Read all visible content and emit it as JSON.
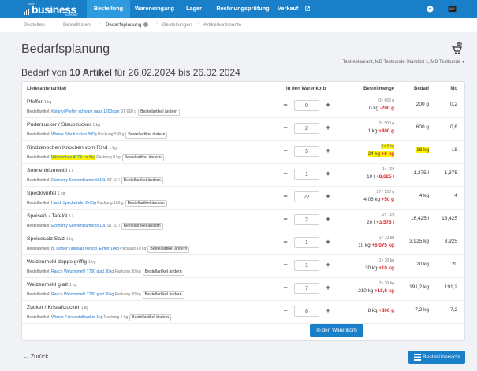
{
  "nav": {
    "logo_pre": "mein",
    "logo_main": "business",
    "logo_sub": "Einkauf",
    "tabs": [
      {
        "label": "Bestellung"
      },
      {
        "label": "Wareneingang"
      },
      {
        "label": "Lager"
      },
      {
        "label": "Rechnungsprüfung"
      },
      {
        "label": "Verkauf"
      }
    ],
    "icons": [
      "help-icon",
      "user-card-icon"
    ]
  },
  "breadcrumb": [
    {
      "label": "Bestellen"
    },
    {
      "label": "Bestelllisten"
    },
    {
      "label": "Bedarfsplanung"
    },
    {
      "label": "Bestellungen"
    },
    {
      "label": "Artikelsortimente"
    }
  ],
  "page": {
    "title": "Bedarfsplanung",
    "cart_count": "24",
    "store": "Testrestaurant, MB Testkunde Standort 1, MB Testkunde",
    "subtitle_pre": "Bedarf von ",
    "subtitle_count": "10 Artikel",
    "subtitle_post": " für 26.02.2024 bis 26.02.2024"
  },
  "table": {
    "headers": [
      "Lieferantenartikel",
      "In den Warenkorb",
      "Bestellmenge",
      "Bedarf",
      "Mo"
    ],
    "art_prefix": "Bestellartikel:",
    "change_label": "Bestellartikel ändern",
    "rows": [
      {
        "name": "Pfeffer",
        "unit": "1 kg",
        "article": "Kotanyi Pfeffer schwarz ganz 1200ccm",
        "pack": "ST 668 g",
        "qty": "0",
        "bm1": "0× 668 g",
        "bm2": "0 kg",
        "bm2_delta": "-200 g",
        "bedarf": "200 g",
        "mo": "0,2"
      },
      {
        "name": "Puderzucker / Staubzucker",
        "unit": "1 kg",
        "article": "Wiener Staubzucker 500g",
        "pack": "Packung 500 g",
        "qty": "2",
        "bm1": "2× 500 g",
        "bm2": "1 kg",
        "bm2_delta": "+400 g",
        "bedarf": "600 g",
        "mo": "0,6"
      },
      {
        "name": "Rindsknochen Knochen vom Rind",
        "unit": "1 kg",
        "article": "Rikknochen ATTK ca 8kg",
        "pack": "Packung 8 kg",
        "qty": "3",
        "bm1": "3× 8 kg",
        "bm2": "24 kg",
        "bm2_delta": "+6 kg",
        "bedarf": "18 kg",
        "mo": "18"
      },
      {
        "name": "Sonnenblumenöl",
        "unit": "1 l",
        "article": "Economy Sonnenblumenöl 10L",
        "pack": "ST 10 l",
        "qty": "1",
        "bm1": "1× 10 l",
        "bm2": "10 l",
        "bm2_delta": "+8,625 l",
        "bedarf": "1,375 l",
        "mo": "1,375"
      },
      {
        "name": "Speckwürfel",
        "unit": "1 kg",
        "article": "Handl Speckwürfel 2x75g",
        "pack": "Packung 150 g",
        "qty": "27",
        "bm1": "27× 150 g",
        "bm2": "4,05 kg",
        "bm2_delta": "+50 g",
        "bedarf": "4 kg",
        "mo": "4"
      },
      {
        "name": "Speiseöl / Tafelöl",
        "unit": "1 l",
        "article": "Economy Sonnenblumenöl 10L",
        "pack": "ST 10 l",
        "qty": "2",
        "bm1": "2× 10 l",
        "bm2": "20 l",
        "bm2_delta": "+3,575 l",
        "bedarf": "16,425 l",
        "mo": "16,425"
      },
      {
        "name": "Speisesalz Salz",
        "unit": "1 kg",
        "article": "B. Ischler Tafelsalz feinjod. Eimer 10kg",
        "pack": "Packung 10 kg",
        "qty": "1",
        "bm1": "1× 10 kg",
        "bm2": "10 kg",
        "bm2_delta": "+6,075 kg",
        "bedarf": "3,925 kg",
        "mo": "3,925"
      },
      {
        "name": "Weizenmehl doppelgriffig",
        "unit": "1 kg",
        "article": "Rauch Weizenmehl T700 glatt 30kg",
        "pack": "Packung 30 kg",
        "qty": "1",
        "bm1": "1× 30 kg",
        "bm2": "30 kg",
        "bm2_delta": "+10 kg",
        "bedarf": "20 kg",
        "mo": "20"
      },
      {
        "name": "Weizenmehl glatt",
        "unit": "1 kg",
        "article": "Rauch Weizenmehl T700 glatt 30kg",
        "pack": "Packung 30 kg",
        "qty": "7",
        "bm1": "7× 30 kg",
        "bm2": "210 kg",
        "bm2_delta": "+18,8 kg",
        "bedarf": "191,2 kg",
        "mo": "191,2"
      },
      {
        "name": "Zucker / Kristallzucker",
        "unit": "1 kg",
        "article": "Wiener Feinkristallzucker 1kg",
        "pack": "Packung 1 kg",
        "qty": "8",
        "bm1": "",
        "bm2": "8 kg",
        "bm2_delta": "+800 g",
        "bedarf": "7,2 kg",
        "mo": "7,2"
      }
    ]
  },
  "buttons": {
    "add_to_cart": "In den Warenkorb",
    "back": "Zurück",
    "overview": "Bestellübersicht"
  }
}
